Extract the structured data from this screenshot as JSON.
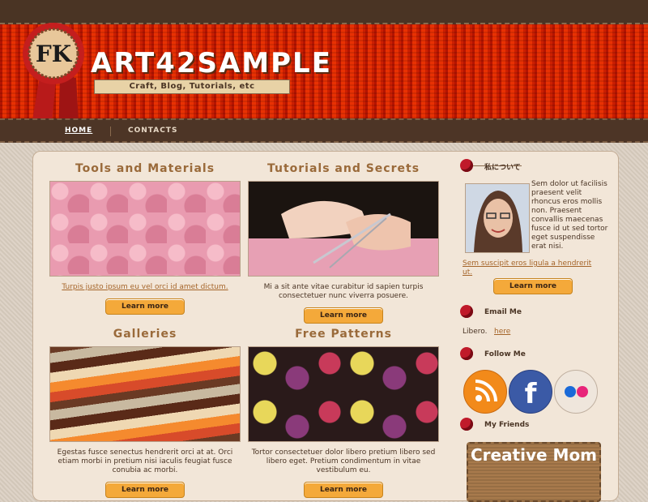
{
  "site": {
    "title": "ART42SAMPLE",
    "tagline": "Craft, Blog, Tutorials, etc",
    "logo_letters": "FK"
  },
  "nav": {
    "items": [
      "HOME",
      "CONTACTS"
    ]
  },
  "cards": [
    {
      "title": "Tools and Materials",
      "desc": "Turpis justo ipsum eu vel orci id amet dictum.",
      "desc_is_link": true,
      "button": "Learn more"
    },
    {
      "title": "Tutorials and Secrets",
      "desc": "Mi a sit ante vitae curabitur id sapien turpis consectetuer nunc viverra posuere.",
      "desc_is_link": false,
      "button": "Learn more"
    },
    {
      "title": "Galleries",
      "desc": "Egestas fusce senectus hendrerit orci at at. Orci etiam morbi in pretium nisi iaculis feugiat fusce conubia ac morbi.",
      "desc_is_link": false,
      "button": "Learn more"
    },
    {
      "title": "Free Patterns",
      "desc": "Tortor consectetuer dolor libero pretium libero sed libero eget. Pretium condimentum in vitae vestibulum eu.",
      "desc_is_link": false,
      "button": "Learn more"
    }
  ],
  "sidebar": {
    "about": {
      "heading": "私について",
      "text": "Sem dolor ut facilisis praesent velit rhoncus eros mollis non. Praesent convallis maecenas fusce id ut sed tortor eget suspendisse erat nisi.",
      "link": "Sem suscipit eros ligula a hendrerit ut.",
      "button": "Learn more"
    },
    "email": {
      "heading": "Email Me",
      "text": "Libero.",
      "link": "here"
    },
    "follow": {
      "heading": "Follow Me",
      "icons": [
        "rss-icon",
        "facebook-icon",
        "flickr-icon"
      ]
    },
    "friends": {
      "heading": "My Friends",
      "badge_text": "Creative Mom"
    }
  }
}
